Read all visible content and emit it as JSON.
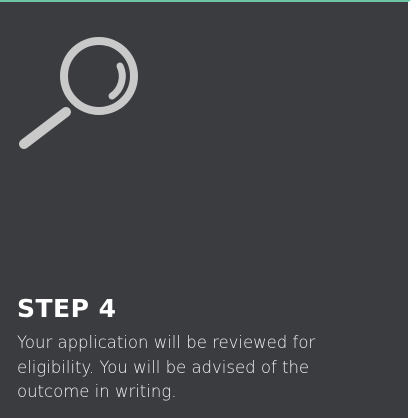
{
  "step": {
    "icon": "magnifying-glass-icon",
    "title": "STEP 4",
    "description": "Your application will be reviewed for eligibility. You will be advised of the outcome in writing."
  },
  "colors": {
    "background": "#3b3c40",
    "accent_top": "#6fc6a4",
    "icon": "#c9c9ca",
    "text": "#ffffff"
  }
}
